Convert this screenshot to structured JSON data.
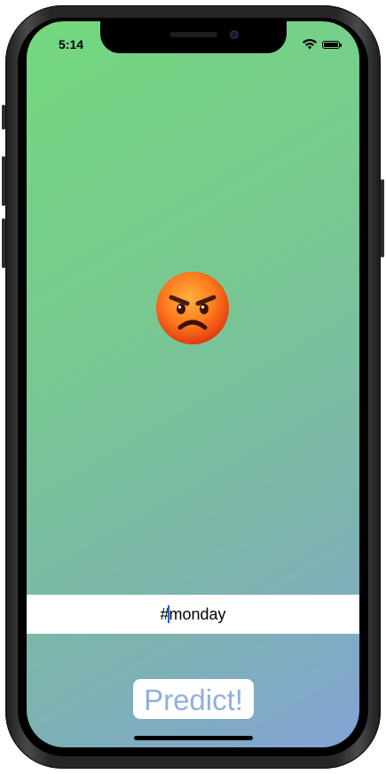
{
  "status_bar": {
    "time": "5:14",
    "icons": [
      "wifi-icon",
      "battery-icon"
    ]
  },
  "prediction": {
    "emoji": "😡",
    "emoji_icon": "angry-face-emoji"
  },
  "hashtag_input": {
    "value_prefix": "#",
    "value_suffix": "monday"
  },
  "predict_button": {
    "label": "Predict!"
  },
  "colors": {
    "gradient_top_left": "#74d97e",
    "gradient_bottom_right": "#83a3d6",
    "button_text": "#8fb0dd",
    "caret": "#2a5bd7"
  }
}
